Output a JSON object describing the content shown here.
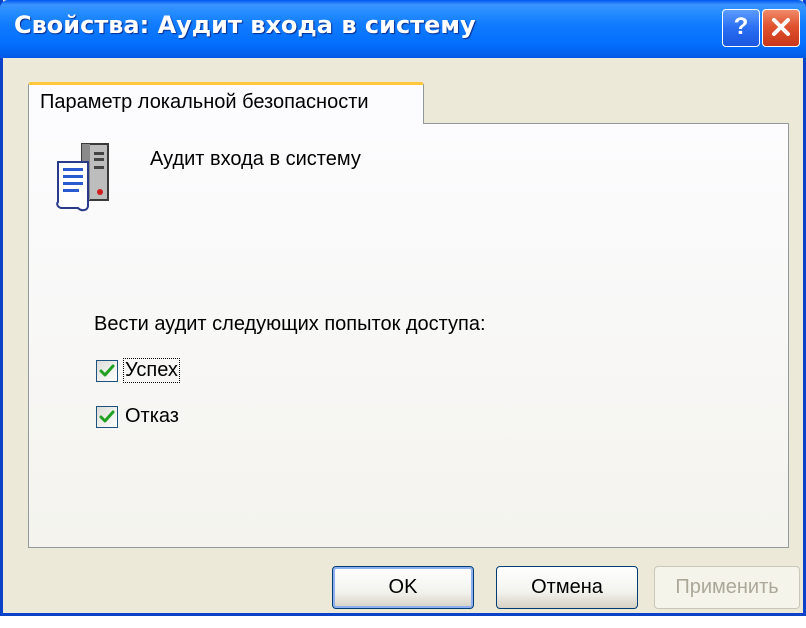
{
  "window": {
    "title": "Свойства: Аудит входа в систему",
    "help_symbol": "?",
    "help_icon": "help-icon",
    "close_icon": "close-icon"
  },
  "tab": {
    "label": "Параметр локальной безопасности"
  },
  "policy": {
    "icon": "server-document-icon",
    "title": "Аудит входа в систему"
  },
  "audit": {
    "prompt": "Вести аудит следующих попыток доступа:",
    "success": {
      "label": "Успех",
      "checked": true
    },
    "failure": {
      "label": "Отказ",
      "checked": true
    }
  },
  "buttons": {
    "ok": "OK",
    "cancel": "Отмена",
    "apply": "Применить",
    "apply_enabled": false
  },
  "colors": {
    "titlebar": "#0a5fe8",
    "dialog_bg": "#ece9d8",
    "tab_highlight": "#ffc83c",
    "checkmark": "#21a121",
    "close_button": "#e0532e"
  }
}
